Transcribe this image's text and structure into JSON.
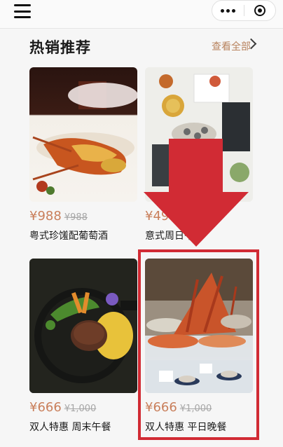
{
  "section": {
    "title": "热销推荐",
    "view_all": "查看全部"
  },
  "products": [
    {
      "price": "¥988",
      "original_price": "¥988",
      "name": "粤式珍馐配葡萄酒"
    },
    {
      "price": "¥49",
      "original_price": "",
      "name": "意式周日午餐"
    },
    {
      "price": "¥666",
      "original_price": "¥1,000",
      "name": "双人特惠 周末午餐"
    },
    {
      "price": "¥666",
      "original_price": "¥1,000",
      "name": "双人特惠 平日晚餐"
    }
  ],
  "colors": {
    "price": "#c97f5b",
    "accent": "#b8835e",
    "annotation": "#d12b34"
  },
  "icons": {
    "menu": "menu-icon",
    "more": "more-icon",
    "close": "close-icon",
    "chevron": "chevron-right-icon"
  }
}
